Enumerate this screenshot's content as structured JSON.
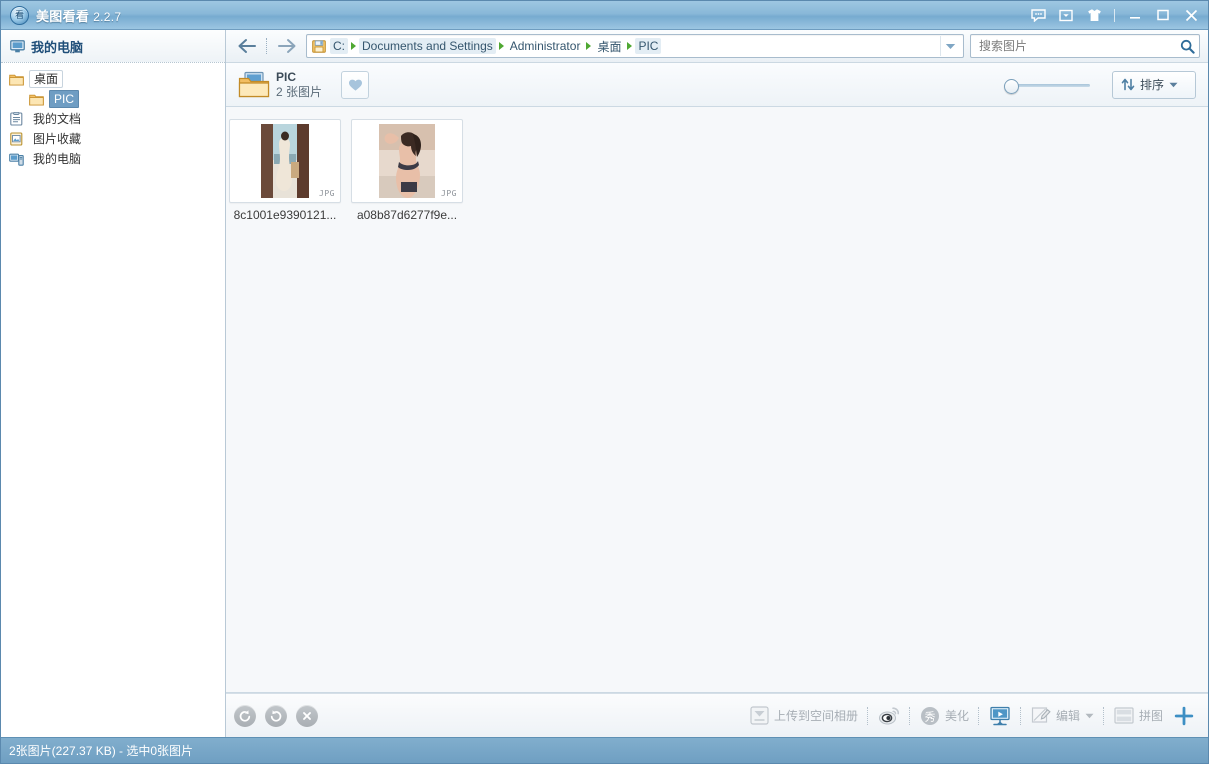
{
  "titlebar": {
    "logo_glyph": "看",
    "app_name": "美图看看",
    "version": "2.2.7",
    "buttons": [
      {
        "name": "feedback-icon",
        "label": "反馈"
      },
      {
        "name": "message-box-icon",
        "label": "消息"
      },
      {
        "name": "skin-icon",
        "label": "换肤"
      }
    ],
    "minimize_label": "最小化",
    "maximize_label": "最大化",
    "close_label": "关闭"
  },
  "sidebar": {
    "header": "我的电脑",
    "items": [
      {
        "label": "桌面",
        "icon": "folder-icon",
        "state": "boxed",
        "indent": false
      },
      {
        "label": "PIC",
        "icon": "folder-icon",
        "state": "selected",
        "indent": true
      },
      {
        "label": "我的文档",
        "icon": "documents-icon",
        "state": "normal",
        "indent": false
      },
      {
        "label": "图片收藏",
        "icon": "pictures-icon",
        "state": "normal",
        "indent": false
      },
      {
        "label": "我的电脑",
        "icon": "computer-icon",
        "state": "normal",
        "indent": false
      }
    ]
  },
  "address": {
    "back_label": "后退",
    "forward_label": "前进",
    "drive_icon": "drive-icon",
    "crumbs": [
      "C:",
      "Documents and Settings",
      "Administrator",
      "桌面",
      "PIC"
    ],
    "dropdown_label": "历史记录"
  },
  "search": {
    "placeholder": "搜索图片",
    "value": "",
    "icon": "search-icon"
  },
  "folderbar": {
    "name": "PIC",
    "count_text": "2 张图片",
    "favorite_label": "收藏",
    "zoom_value": 0,
    "sort_label": "排序"
  },
  "thumbnails": [
    {
      "name": "8c1001e9390121...",
      "type": "JPG"
    },
    {
      "name": "a08b87d6277f9e...",
      "type": "JPG"
    }
  ],
  "toolbar": {
    "rotate_left_label": "向左旋转",
    "rotate_right_label": "向右旋转",
    "delete_label": "删除",
    "upload_label": "上传到空间相册",
    "weibo_label": "分享到微博",
    "beautify_badge": "秀",
    "beautify_label": "美化",
    "slideshow_label": "幻灯片放映",
    "edit_label": "编辑",
    "collage_label": "拼图",
    "add_label": "添加"
  },
  "statusbar": {
    "text": "2张图片(227.37 KB) - 选中0张图片"
  },
  "colors": {
    "accent": "#6f9fc2",
    "title_gradient_top": "#9ec7e2",
    "selection": "#6f9dc3",
    "crumb_sep": "#4fa832",
    "plus": "#3d8fc4"
  }
}
